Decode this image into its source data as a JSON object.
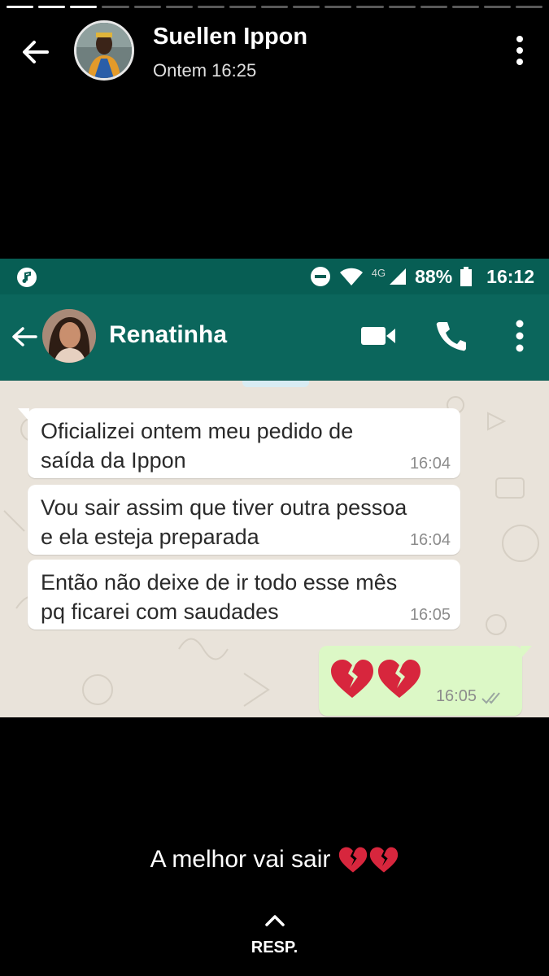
{
  "story": {
    "segments_total": 17,
    "segments_viewed": 3,
    "author": "Suellen Ippon",
    "timestamp": "Ontem 16:25",
    "caption": "A melhor vai sair",
    "caption_emoji": [
      "broken-heart",
      "broken-heart"
    ],
    "reply_label": "RESP."
  },
  "screenshot": {
    "status_bar": {
      "battery": "88%",
      "time": "16:12",
      "network": "4G",
      "icons": [
        "music-icon",
        "do-not-disturb-icon",
        "wifi-icon",
        "signal-icon",
        "battery-icon"
      ]
    },
    "chat_header": {
      "contact_name": "Renatinha",
      "icons": [
        "back-arrow-icon",
        "video-call-icon",
        "phone-icon",
        "more-vert-icon"
      ]
    },
    "messages": [
      {
        "direction": "incoming",
        "text_line1": "Oficializei ontem meu pedido de",
        "text_line2": "saída da Ippon",
        "time": "16:04"
      },
      {
        "direction": "incoming",
        "text_line1": "Vou sair assim que tiver outra pessoa",
        "text_line2": "e ela esteja preparada",
        "time": "16:04"
      },
      {
        "direction": "incoming",
        "text_line1": "Então não deixe de ir todo esse mês",
        "text_line2": "pq ficarei com saudades",
        "time": "16:05"
      },
      {
        "direction": "outgoing",
        "emoji": [
          "broken-heart",
          "broken-heart"
        ],
        "time": "16:05",
        "status": "read"
      }
    ]
  },
  "colors": {
    "whatsapp_header": "#0b665c",
    "status_bar": "#075e54",
    "chat_background": "#e9e3da",
    "outgoing_bubble": "#dcf8c6",
    "incoming_bubble": "#ffffff",
    "broken_heart": "#d7263d"
  }
}
